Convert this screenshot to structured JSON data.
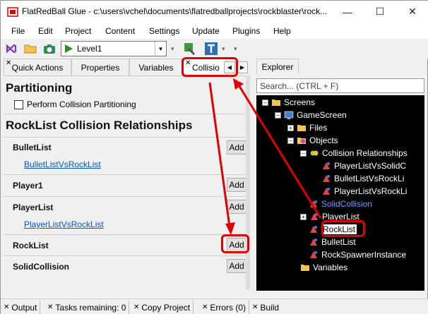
{
  "window": {
    "title": "FlatRedBall Glue - c:\\users\\vchel\\documents\\flatredballprojects\\rockblaster\\rock..."
  },
  "menu": [
    "File",
    "Edit",
    "Project",
    "Content",
    "Settings",
    "Update",
    "Plugins",
    "Help"
  ],
  "toolbar": {
    "level_value": "Level1"
  },
  "tabs": [
    {
      "label": "Quick Actions"
    },
    {
      "label": "Properties"
    },
    {
      "label": "Variables"
    },
    {
      "label": "Collisio"
    }
  ],
  "partitioning": {
    "heading": "Partitioning",
    "checkbox_label": "Perform Collision Partitioning"
  },
  "relationships": {
    "heading": "RockList Collision Relationships",
    "add_label": "Add",
    "groups": [
      {
        "label": "BulletList",
        "link": "BulletListVsRockList"
      },
      {
        "label": "Player1",
        "link": ""
      },
      {
        "label": "PlayerList",
        "link": "PlayerListVsRockList"
      },
      {
        "label": "RockList",
        "link": ""
      },
      {
        "label": "SolidCollision",
        "link": ""
      }
    ]
  },
  "explorer": {
    "tab": "Explorer",
    "search_placeholder": "Search... (CTRL + F)",
    "nodes": [
      {
        "text": "Screens"
      },
      {
        "text": "GameScreen"
      },
      {
        "text": "Files"
      },
      {
        "text": "Objects"
      },
      {
        "text": "Collision Relationships"
      },
      {
        "text": "PlayerListVsSolidC"
      },
      {
        "text": "BulletListVsRockLi"
      },
      {
        "text": "PlayerListVsRockLi"
      },
      {
        "text": "SolidCollision"
      },
      {
        "text": "PlayerList"
      },
      {
        "text": "RockList"
      },
      {
        "text": "BulletList"
      },
      {
        "text": "RockSpawnerInstance"
      },
      {
        "text": "Variables"
      }
    ]
  },
  "status": [
    {
      "label": "Output"
    },
    {
      "label": "Tasks remaining: 0"
    },
    {
      "label": "Copy Project"
    },
    {
      "label": "Errors (0)"
    },
    {
      "label": "Build"
    }
  ],
  "colors": {
    "highlight": "#e00000",
    "link": "#0055cc",
    "tree_bg": "#000000"
  }
}
